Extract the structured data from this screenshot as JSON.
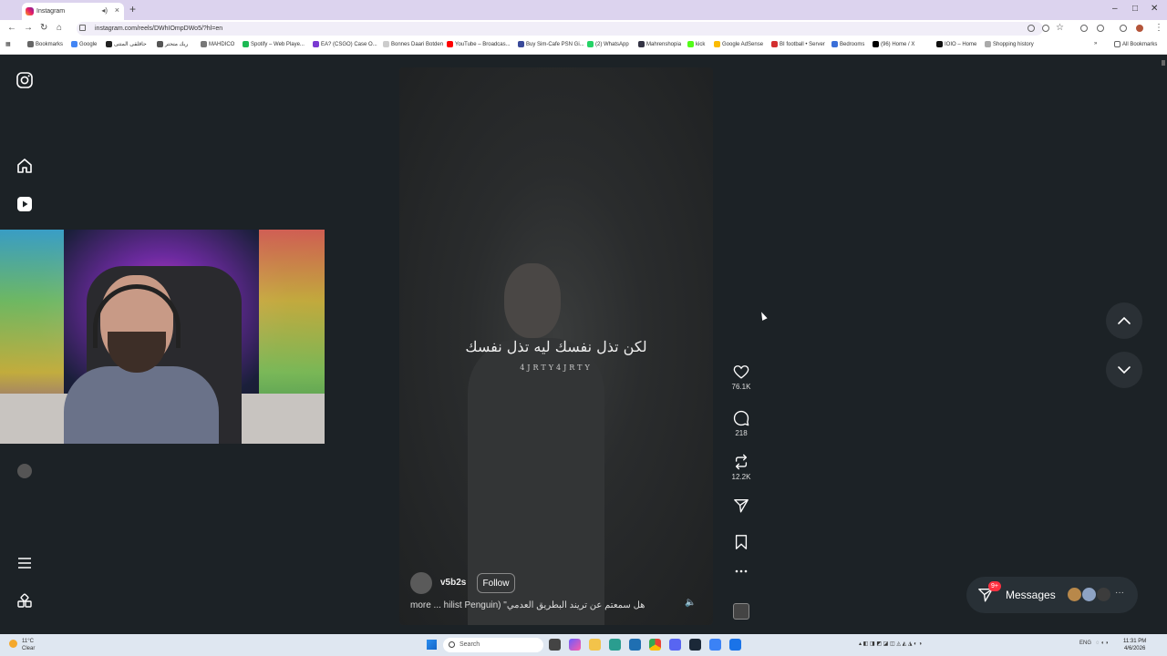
{
  "browser": {
    "tab_title": "Instagram",
    "url": "instagram.com/reels/DWhIOmpDWo5/?hl=en",
    "bookmarks": [
      "Bookmarks",
      "Google",
      "حاقلقى المتتى",
      "ريك متحتر",
      "MAHDICO",
      "Spotify – Web Playe...",
      "EA? (CSGO) Case O...",
      "Bonnes Daari Botden",
      "YouTube – Broadcas...",
      "Buy Sim-Cafe PSN Gi...",
      "(2) WhatsApp",
      "Mahrenshopia",
      "kick",
      "Google AdSense",
      "BI football • Server",
      "Bedrooms",
      "(96) Home / X",
      "IOIO – Home",
      "Shopping history"
    ],
    "all_bookmarks": "All Bookmarks"
  },
  "reel": {
    "caption_ar": "لكن تذل نفسك ليه تذل نفسك",
    "caption_sub": "4JRTY4JRTY",
    "username": "v5b2s",
    "follow_label": "Follow",
    "description": "more ... hilist Penguin) \"هل سمعتم عن تريند البطريق العدمي"
  },
  "actions": {
    "likes": "76.1K",
    "comments": "218",
    "reposts": "12.2K"
  },
  "messages": {
    "label": "Messages",
    "badge": "9+"
  },
  "taskbar": {
    "weather_temp": "11°C",
    "weather_desc": "Clear",
    "search_placeholder": "Search",
    "lang": "ENG",
    "time": "11:31 PM",
    "date": "4/6/2026"
  },
  "colors": {
    "page_bg": "#1c2226",
    "badge": "#ff3040",
    "browser_frame": "#dcd3ee"
  }
}
